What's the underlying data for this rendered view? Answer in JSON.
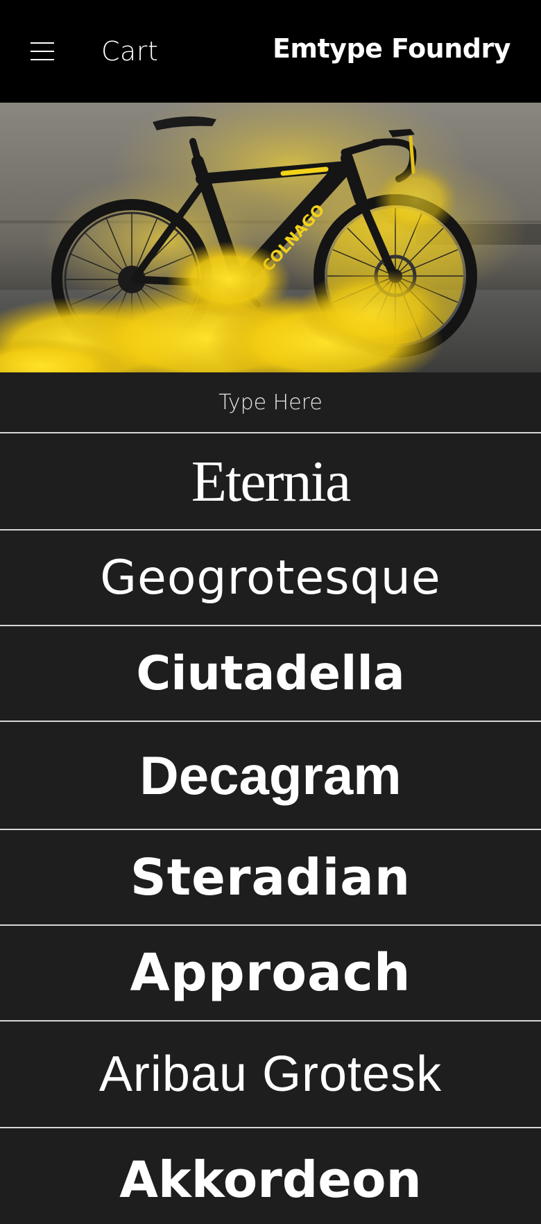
{
  "header": {
    "menu_icon": "hamburger-menu-icon",
    "cart_label": "Cart",
    "brand": "Emtype Foundry"
  },
  "hero": {
    "image": "black-and-yellow-road-bicycle-in-yellow-smoke",
    "frame_text": "COLNAGO",
    "colors": {
      "smoke": "#f3d21a",
      "frame": "#1a1a1a",
      "wall": "#6f6c66"
    }
  },
  "type_input": {
    "placeholder": "Type Here"
  },
  "fonts": [
    {
      "name": "Eternia"
    },
    {
      "name": "Geogrotesque"
    },
    {
      "name": "Ciutadella"
    },
    {
      "name": "Decagram"
    },
    {
      "name": "Steradian"
    },
    {
      "name": "Approach"
    },
    {
      "name": "Aribau Grotesk"
    },
    {
      "name": "Akkordeon"
    }
  ],
  "colors": {
    "header_bg": "#000000",
    "list_bg": "#1e1e1e",
    "divider": "#d8d8d8",
    "text": "#ffffff"
  }
}
